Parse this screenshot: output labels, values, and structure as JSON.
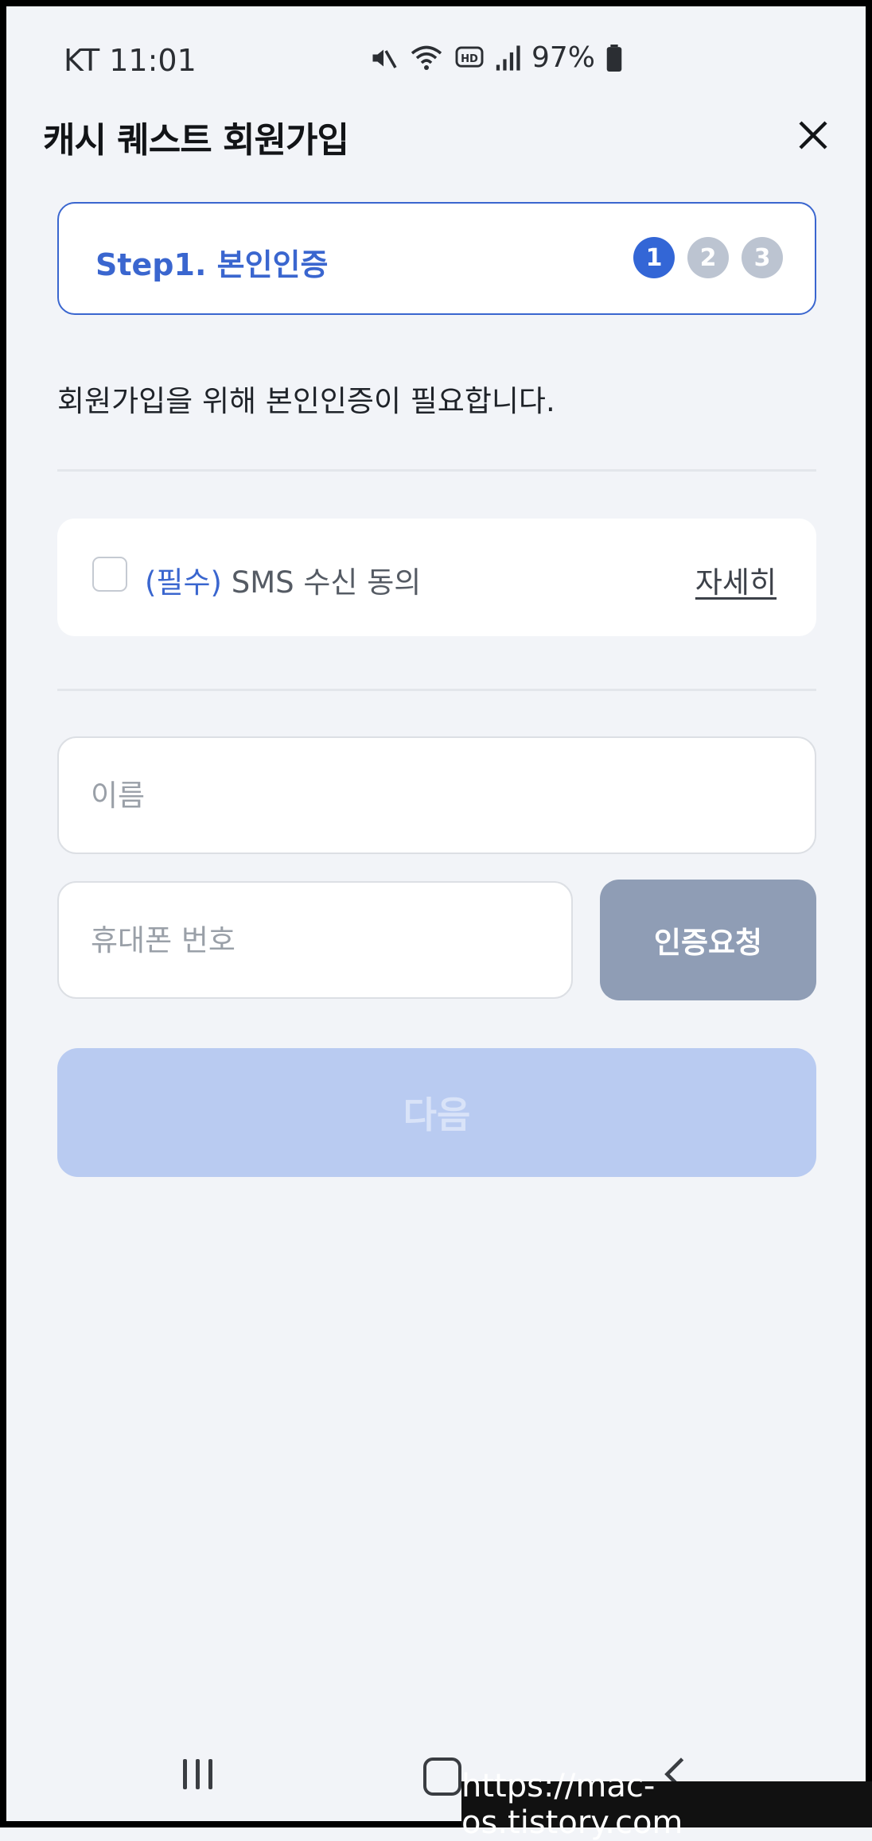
{
  "status_bar": {
    "carrier_time": "KT 11:01",
    "battery": "97%",
    "icons": [
      "mute-icon",
      "wifi-icon",
      "hd-icon",
      "signal-icon",
      "battery-icon"
    ]
  },
  "header": {
    "title": "캐시 퀘스트 회원가입"
  },
  "step": {
    "label": "Step1. 본인인증",
    "steps": [
      "1",
      "2",
      "3"
    ],
    "current": 1
  },
  "description": "회원가입을 위해 본인인증이 필요합니다.",
  "consent": {
    "required_tag": "(필수)",
    "text": "SMS 수신 동의",
    "detail_link": "자세히",
    "checked": false
  },
  "form": {
    "name_placeholder": "이름",
    "phone_placeholder": "휴대폰 번호",
    "verify_button": "인증요청",
    "next_button": "다음"
  },
  "watermark": "https://mac-os.tistory.com",
  "colors": {
    "accent": "#3366d6",
    "background": "#f2f4f8",
    "disabled_button": "#b9cbf1",
    "verify_button": "#8f9db5"
  }
}
